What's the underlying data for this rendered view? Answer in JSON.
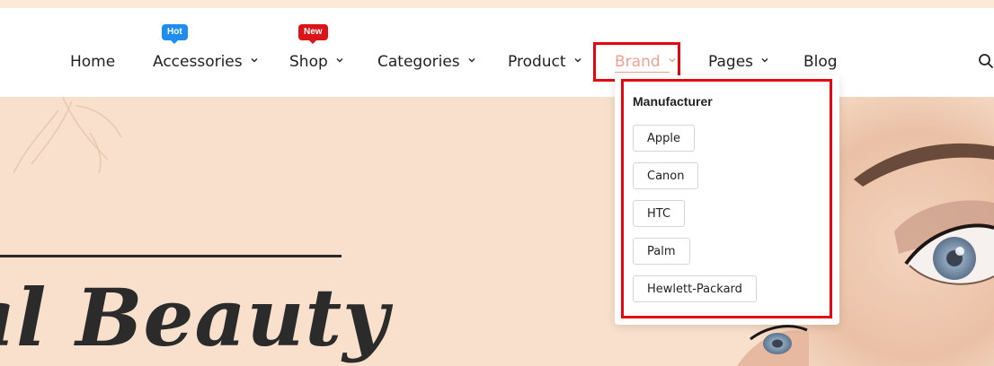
{
  "nav": {
    "items": [
      {
        "label": "Home"
      },
      {
        "label": "Accessories",
        "badge": "Hot"
      },
      {
        "label": "Shop",
        "badge": "New"
      },
      {
        "label": "Categories"
      },
      {
        "label": "Product"
      },
      {
        "label": "Brand"
      },
      {
        "label": "Pages"
      },
      {
        "label": "Blog"
      }
    ]
  },
  "dropdown": {
    "title": "Manufacturer",
    "options": [
      "Apple",
      "Canon",
      "HTC",
      "Palm",
      "Hewlett-Packard"
    ]
  },
  "hero": {
    "text": "al Beauty"
  },
  "colors": {
    "accent": "#e8a494",
    "highlight": "#e3060f",
    "hero_bg": "#f8e0cc",
    "badge_hot": "#1f8cf0",
    "badge_new": "#d9151a"
  },
  "icons": [
    "chevron-down-icon",
    "search-icon"
  ]
}
